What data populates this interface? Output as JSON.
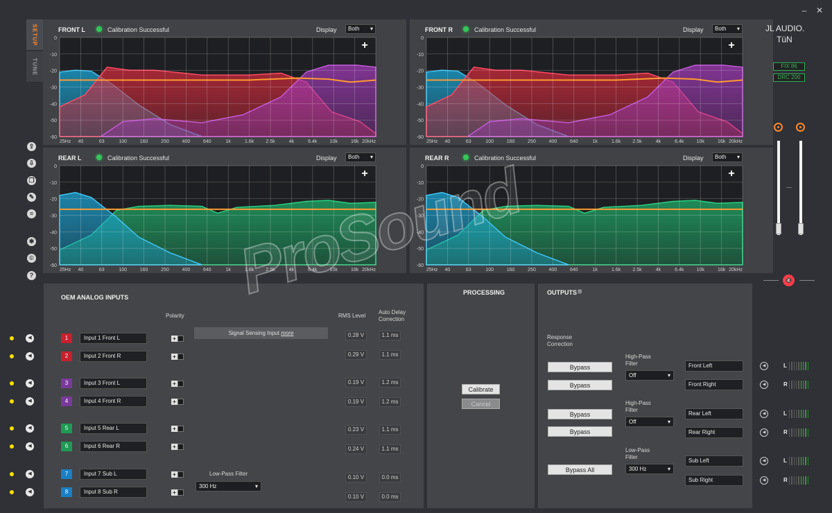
{
  "window": {
    "minimize": "–",
    "close": "✕"
  },
  "side_tabs": [
    "SETUP",
    "TUNE"
  ],
  "rail_icons": [
    "upload-icon",
    "download-icon",
    "copy-icon",
    "wrench-icon",
    "list-icon",
    "gear-icon",
    "copyright-icon",
    "help-icon"
  ],
  "rail_glyphs": [
    "⇪",
    "⇩",
    "❐",
    "✎",
    "≡",
    "✱",
    "©",
    "?"
  ],
  "graphs": [
    {
      "title": "FRONT L",
      "status": "Calibration Successful",
      "display_label": "Display",
      "display_value": "Both"
    },
    {
      "title": "FRONT R",
      "status": "Calibration Successful",
      "display_label": "Display",
      "display_value": "Both"
    },
    {
      "title": "REAR L",
      "status": "Calibration Successful",
      "display_label": "Display",
      "display_value": "Both"
    },
    {
      "title": "REAR R",
      "status": "Calibration Successful",
      "display_label": "Display",
      "display_value": "Both"
    }
  ],
  "graph_axes": {
    "y_ticks": [
      "0",
      "-10",
      "-20",
      "-30",
      "-40",
      "-50",
      "-60"
    ],
    "x_ticks": [
      "25Hz",
      "40",
      "63",
      "100",
      "160",
      "250",
      "400",
      "640",
      "1k",
      "1.6k",
      "2.5k",
      "4k",
      "6.4k",
      "10k",
      "16k",
      "20kHz"
    ]
  },
  "brand": {
    "line1": "JL AUDIO.",
    "line2": "TüN",
    "tag1": "FIX 86",
    "tag2": "DRC 200"
  },
  "watermark": "ProSound",
  "inputs": {
    "title": "OEM ANALOG INPUTS",
    "polarity_label": "Polarity",
    "rms_label": "RMS Level",
    "delay_label": "Auto Delay Correction",
    "signal_sensing": "Signal Sensing Input",
    "signal_more": "more",
    "lowpass_label": "Low-Pass Filter",
    "lowpass_value": "300 Hz",
    "rows": [
      {
        "num": "1",
        "name": "Input 1 Front L",
        "color": "#c8202e",
        "rms": "0.28 V",
        "delay": "1.1 ms"
      },
      {
        "num": "2",
        "name": "Input 2 Front R",
        "color": "#c8202e",
        "rms": "0.29 V",
        "delay": "1.1 ms"
      },
      {
        "num": "3",
        "name": "Input 3 Front L",
        "color": "#7a3a9a",
        "rms": "0.19 V",
        "delay": "1.2 ms"
      },
      {
        "num": "4",
        "name": "Input 4 Front R",
        "color": "#7a3a9a",
        "rms": "0.19 V",
        "delay": "1.2 ms"
      },
      {
        "num": "5",
        "name": "Input 5 Rear L",
        "color": "#1f9a55",
        "rms": "0.23 V",
        "delay": "1.1 ms"
      },
      {
        "num": "6",
        "name": "Input 6 Rear R",
        "color": "#1f9a55",
        "rms": "0.24 V",
        "delay": "1.1 ms"
      },
      {
        "num": "7",
        "name": "Input 7 Sub L",
        "color": "#1a7fc4",
        "rms": "0.10 V",
        "delay": "0.0 ms"
      },
      {
        "num": "8",
        "name": "Input 8 Sub R",
        "color": "#1a7fc4",
        "rms": "0.10 V",
        "delay": "0.0 ms"
      }
    ]
  },
  "processing": {
    "title": "PROCESSING",
    "calibrate": "Calibrate",
    "cancel": "Cancel"
  },
  "outputs": {
    "title": "OUTPUTS",
    "menu_glyph": "≡",
    "response_label": "Response Correction",
    "bypass": "Bypass",
    "bypass_all": "Bypass All",
    "hpf_label": "High-Pass Filter",
    "lpf_label": "Low-Pass Filter",
    "hpf1": "Off",
    "hpf2": "Off",
    "lpf": "300 Hz",
    "channels": [
      {
        "name": "Front Left",
        "side": "L"
      },
      {
        "name": "Front Right",
        "side": "R"
      },
      {
        "name": "Rear Left",
        "side": "L"
      },
      {
        "name": "Rear Right",
        "side": "R"
      },
      {
        "name": "Sub Left",
        "side": "L"
      },
      {
        "name": "Sub Right",
        "side": "R"
      }
    ]
  },
  "colors": {
    "accent": "#ff8a2a",
    "ok": "#34c759",
    "mute": "#ff3b4a"
  }
}
